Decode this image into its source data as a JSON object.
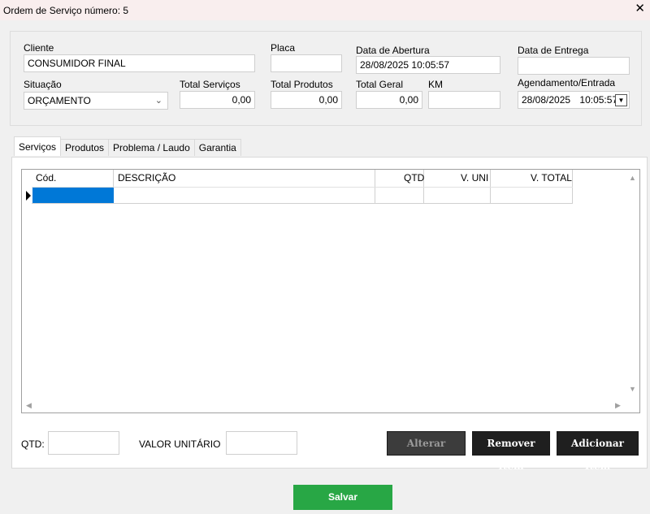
{
  "window": {
    "title": "Ordem de Serviço número: 5",
    "close_glyph": "✕"
  },
  "header": {
    "cliente": {
      "label": "Cliente",
      "value": "CONSUMIDOR FINAL"
    },
    "placa": {
      "label": "Placa",
      "value": ""
    },
    "data_abertura": {
      "label": "Data de Abertura",
      "value": "28/08/2025 10:05:57"
    },
    "data_entrega": {
      "label": "Data de Entrega",
      "value": ""
    },
    "situacao": {
      "label": "Situação",
      "value": "ORÇAMENTO"
    },
    "total_servicos": {
      "label": "Total Serviços",
      "value": "0,00"
    },
    "total_produtos": {
      "label": "Total Produtos",
      "value": "0,00"
    },
    "total_geral": {
      "label": "Total Geral",
      "value": "0,00"
    },
    "km": {
      "label": "KM",
      "value": ""
    },
    "agendamento": {
      "label": "Agendamento/Entrada",
      "date": "28/08/2025",
      "time": "10:05:57"
    }
  },
  "tabs": [
    {
      "label": "Serviços",
      "active": true
    },
    {
      "label": "Produtos",
      "active": false
    },
    {
      "label": "Problema / Laudo",
      "active": false
    },
    {
      "label": "Garantia",
      "active": false
    }
  ],
  "grid": {
    "columns": [
      "Cód.",
      "DESCRIÇÃO",
      "QTD",
      "V. UNI",
      "V. TOTAL"
    ],
    "rows": [
      [
        "",
        "",
        "",
        "",
        ""
      ]
    ]
  },
  "bottom": {
    "qtd_label": "QTD:",
    "qtd_value": "",
    "valor_label": "VALOR UNITÁRIO",
    "valor_value": "",
    "alterar_label": "Alterar",
    "remover_label": "Remover Item",
    "adicionar_label": "Adicionar Item"
  },
  "save_label": "Salvar",
  "colors": {
    "save": "#28a745",
    "selection": "#0078d7",
    "button": "#1f1f1f"
  }
}
